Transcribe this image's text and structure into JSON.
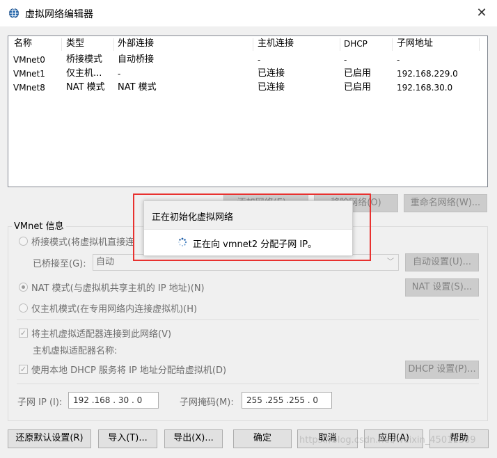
{
  "window": {
    "title": "虚拟网络编辑器",
    "close_glyph": "✕"
  },
  "table": {
    "columns": [
      "名称",
      "类型",
      "外部连接",
      "主机连接",
      "DHCP",
      "子网地址"
    ],
    "rows": [
      [
        "VMnet0",
        "桥接模式",
        "自动桥接",
        "-",
        "-",
        "-"
      ],
      [
        "VMnet1",
        "仅主机...",
        "-",
        "已连接",
        "已启用",
        "192.168.229.0"
      ],
      [
        "VMnet8",
        "NAT 模式",
        "NAT 模式",
        "已连接",
        "已启用",
        "192.168.30.0"
      ]
    ]
  },
  "net_buttons": {
    "add": "添加网络(E)...",
    "remove": "移除网络(O)",
    "rename": "重命名网络(W)..."
  },
  "vmnet_info": {
    "group_label": "VMnet 信息",
    "bridged_label": "桥接模式(将虚拟机直接连",
    "bridged_to_label": "已桥接至(G):",
    "bridged_to_value": "自动",
    "auto_settings": "自动设置(U)...",
    "nat_label": "NAT 模式(与虚拟机共享主机的 IP 地址)(N)",
    "nat_settings": "NAT 设置(S)...",
    "hostonly_label": "仅主机模式(在专用网络内连接虚拟机)(H)",
    "connect_adapter_label": "将主机虚拟适配器连接到此网络(V)",
    "adapter_name_label": "主机虚拟适配器名称:",
    "dhcp_label": "使用本地 DHCP 服务将 IP 地址分配给虚拟机(D)",
    "dhcp_settings": "DHCP 设置(P)...",
    "subnet_ip_label": "子网 IP (I):",
    "subnet_ip_value": "192 .168 . 30  .  0",
    "subnet_mask_label": "子网掩码(M):",
    "subnet_mask_value": "255 .255 .255 .  0",
    "selected_mode": "nat"
  },
  "bottom_buttons": {
    "restore": "还原默认设置(R)",
    "import": "导入(T)...",
    "export": "导出(X)...",
    "ok": "确定",
    "cancel": "取消",
    "apply": "应用(A)",
    "help": "帮助"
  },
  "popup": {
    "title": "正在初始化虚拟网络",
    "message": "正在向 vmnet2 分配子网 IP。"
  },
  "watermark": "https://blog.csdn.net/weixin_45011389",
  "colors": {
    "highlight": "#e8312f",
    "accent": "#2b6cb0"
  }
}
